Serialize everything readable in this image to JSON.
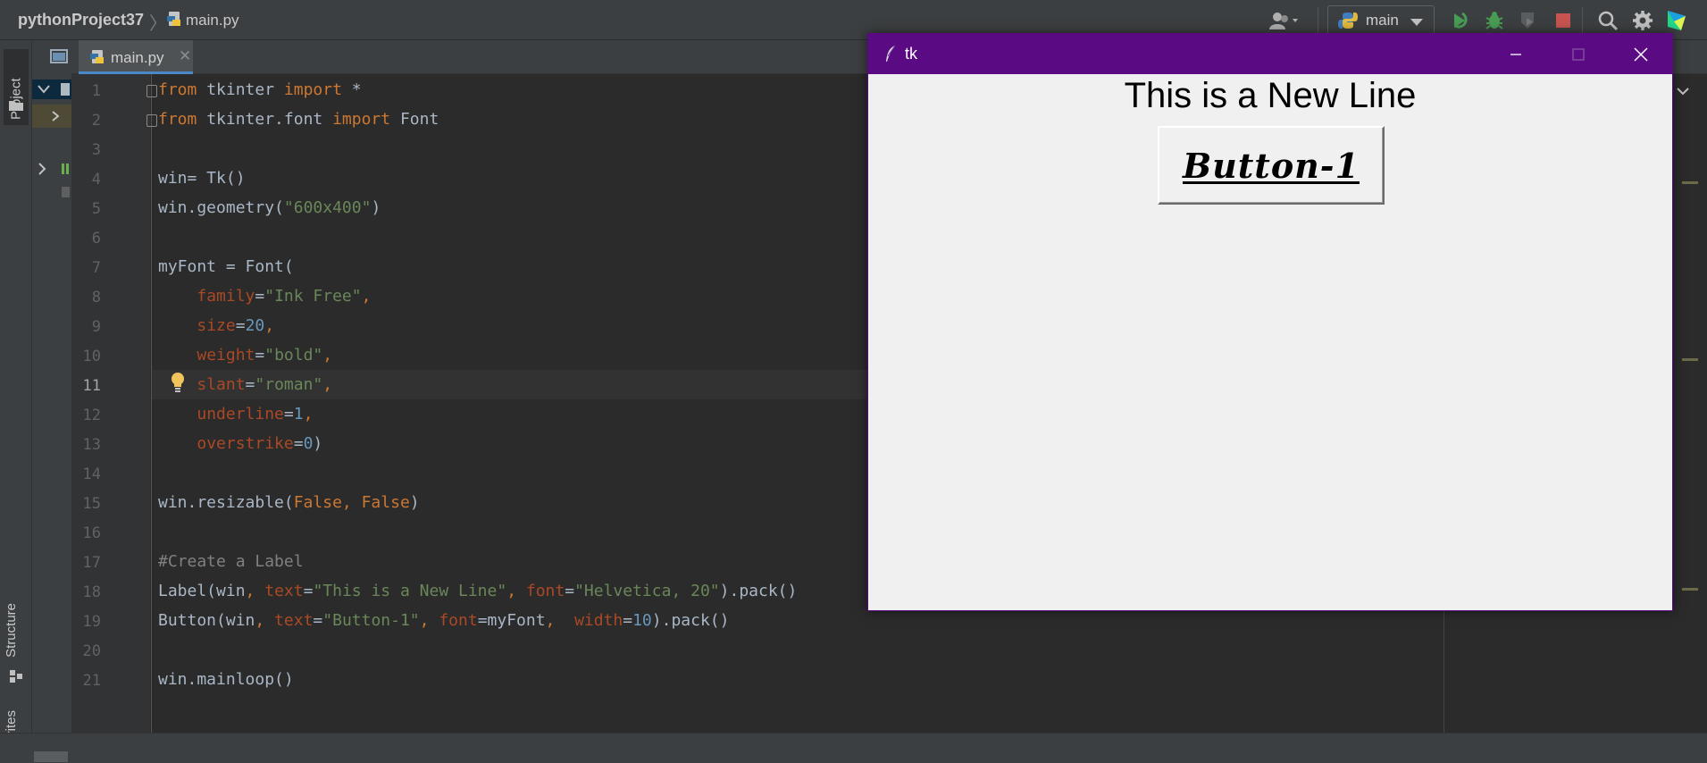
{
  "navbar": {
    "project_name": "pythonProject37",
    "file_name": "main.py",
    "run_config": "main"
  },
  "left_strip": {
    "project_tab": "Project",
    "structure_tab": "Structure",
    "favorites_tab": "Favorites"
  },
  "editor": {
    "tab_label": "main.py",
    "current_line": 11,
    "line_numbers": [
      "1",
      "2",
      "3",
      "4",
      "5",
      "6",
      "7",
      "8",
      "9",
      "10",
      "11",
      "12",
      "13",
      "14",
      "15",
      "16",
      "17",
      "18",
      "19",
      "20",
      "21"
    ]
  },
  "code": {
    "l1": [
      "from",
      " tkinter ",
      "import",
      " *"
    ],
    "l2": [
      "from",
      " tkinter.font ",
      "import",
      " Font"
    ],
    "l4": "win= Tk()",
    "l5": [
      "win.geometry(",
      "\"600x400\"",
      ")"
    ],
    "l7": "myFont = Font(",
    "l8": [
      "family",
      "=",
      "\"Ink Free\"",
      ","
    ],
    "l9": [
      "size",
      "=",
      "20",
      ","
    ],
    "l10": [
      "weight",
      "=",
      "\"bold\"",
      ","
    ],
    "l11": [
      "slant",
      "=",
      "\"roman\"",
      ","
    ],
    "l12": [
      "underline",
      "=",
      "1",
      ","
    ],
    "l13": [
      "overstrike",
      "=",
      "0",
      ")"
    ],
    "l15": [
      "win.resizable(",
      "False",
      ", ",
      "False",
      ")"
    ],
    "l17": "#Create a Label",
    "l18": [
      "Label(win",
      ", ",
      "text",
      "=",
      "\"This is a New Line\"",
      ", ",
      "font",
      "=",
      "\"Helvetica, 20\"",
      ").pack()"
    ],
    "l19": [
      "Button(win",
      ", ",
      "text",
      "=",
      "\"Button-1\"",
      ", ",
      "font",
      "=myFont",
      ",  ",
      "width",
      "=",
      "10",
      ").pack()"
    ],
    "l21": "win.mainloop()"
  },
  "tk_window": {
    "title": "tk",
    "label_text": "This is a New Line",
    "button_text": "Button-1",
    "titlebar_color": "#5a0a82"
  },
  "icons": {
    "navbar": [
      "user-icon",
      "python-icon",
      "rerun-icon",
      "debug-icon",
      "coverage-icon",
      "stop-icon",
      "search-icon",
      "settings-icon",
      "jetbrains-icon"
    ]
  }
}
